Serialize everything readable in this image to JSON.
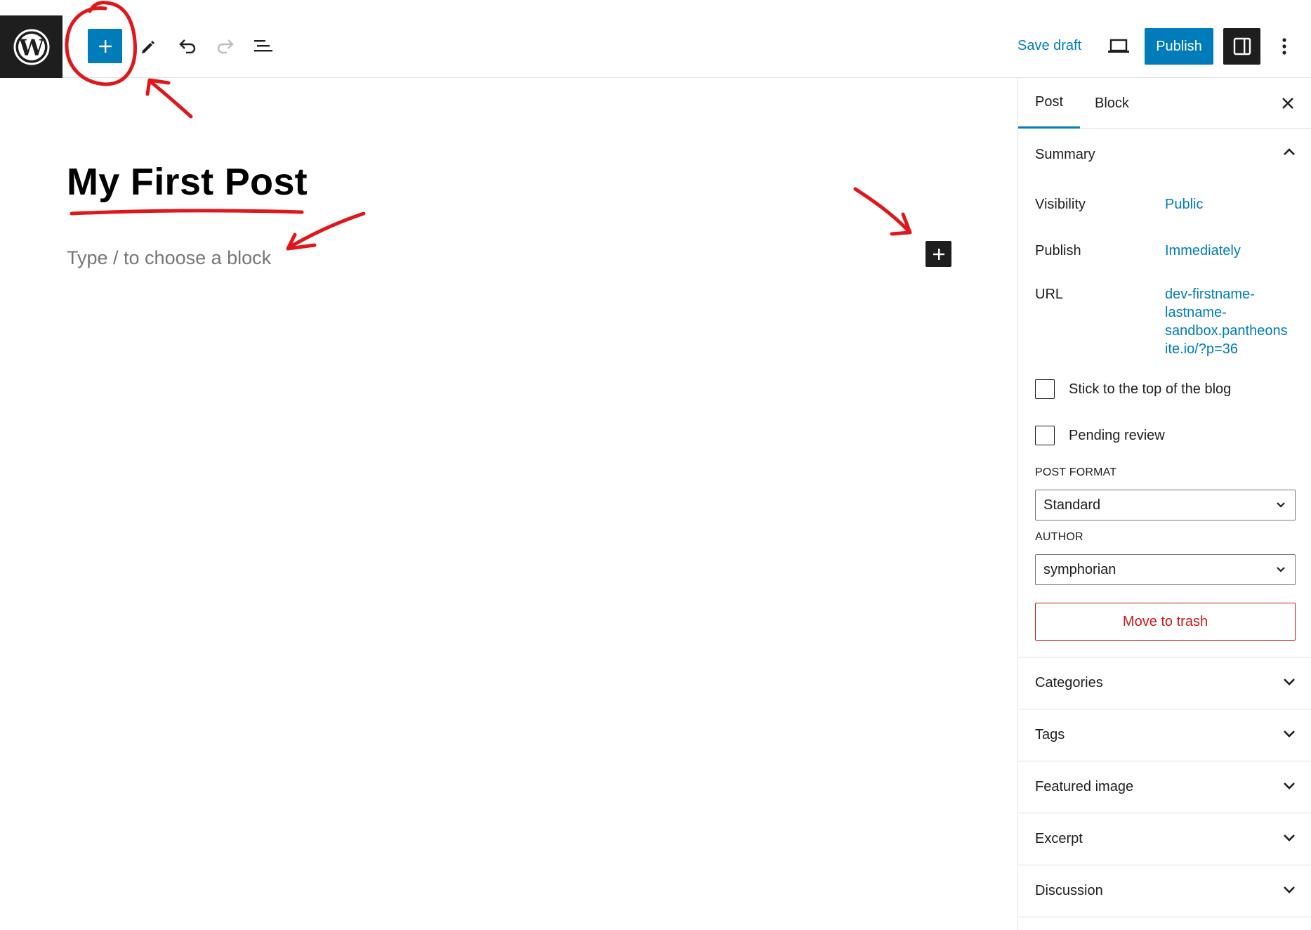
{
  "toolbar": {
    "save_draft_label": "Save draft",
    "publish_label": "Publish",
    "icons": [
      "wordpress-logo",
      "plus-icon",
      "pencil-icon",
      "undo-icon",
      "redo-icon",
      "list-view-icon",
      "laptop-icon",
      "sidebar-icon",
      "more-vertical-icon"
    ]
  },
  "editor": {
    "title": "My First Post",
    "placeholder": "Type / to choose a block"
  },
  "sidebar": {
    "tabs": [
      {
        "label": "Post",
        "active": true
      },
      {
        "label": "Block",
        "active": false
      }
    ],
    "summary": {
      "title": "Summary",
      "visibility_label": "Visibility",
      "visibility_value": "Public",
      "publish_label": "Publish",
      "publish_value": "Immediately",
      "url_label": "URL",
      "url_lines": [
        "dev-firstname-",
        "lastname-",
        "sandbox.pantheons",
        "ite.io/?p=36"
      ],
      "sticky_label": "Stick to the top of the blog",
      "pending_label": "Pending review",
      "post_format_label": "POST FORMAT",
      "post_format_value": "Standard",
      "author_label": "AUTHOR",
      "author_value": "symphorian",
      "trash_label": "Move to trash"
    },
    "panels": [
      {
        "label": "Categories"
      },
      {
        "label": "Tags"
      },
      {
        "label": "Featured image"
      },
      {
        "label": "Excerpt"
      },
      {
        "label": "Discussion"
      }
    ]
  },
  "colors": {
    "accent": "#007cba",
    "dark": "#1e1e1e",
    "danger": "#cc1818",
    "annotation": "#e0161b"
  }
}
